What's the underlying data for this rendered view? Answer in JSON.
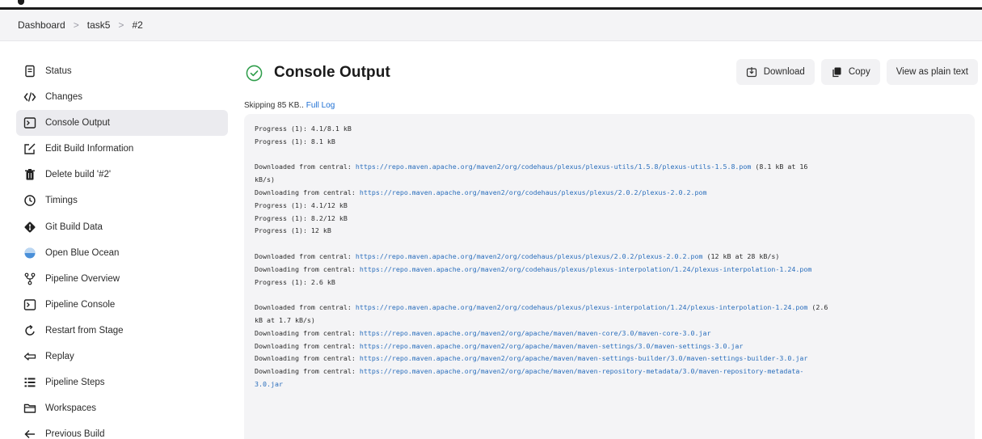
{
  "breadcrumb": {
    "items": [
      "Dashboard",
      "task5",
      "#2"
    ],
    "separator": ">"
  },
  "sidebar": {
    "items": [
      {
        "label": "Status",
        "icon": "document-icon"
      },
      {
        "label": "Changes",
        "icon": "code-icon"
      },
      {
        "label": "Console Output",
        "icon": "terminal-icon",
        "active": true
      },
      {
        "label": "Edit Build Information",
        "icon": "edit-icon"
      },
      {
        "label": "Delete build '#2'",
        "icon": "trash-icon"
      },
      {
        "label": "Timings",
        "icon": "clock-icon"
      },
      {
        "label": "Git Build Data",
        "icon": "git-icon"
      },
      {
        "label": "Open Blue Ocean",
        "icon": "blue-ocean-icon"
      },
      {
        "label": "Pipeline Overview",
        "icon": "pipeline-icon"
      },
      {
        "label": "Pipeline Console",
        "icon": "terminal-icon"
      },
      {
        "label": "Restart from Stage",
        "icon": "restart-icon"
      },
      {
        "label": "Replay",
        "icon": "replay-icon"
      },
      {
        "label": "Pipeline Steps",
        "icon": "list-icon"
      },
      {
        "label": "Workspaces",
        "icon": "folder-icon"
      },
      {
        "label": "Previous Build",
        "icon": "arrow-left-icon"
      }
    ]
  },
  "main": {
    "title": "Console Output",
    "actions": {
      "download": "Download",
      "copy": "Copy",
      "plain": "View as plain text"
    },
    "skip_text": "Skipping 85 KB..",
    "full_log": "Full Log"
  },
  "console": {
    "lines": [
      {
        "text": "Progress (1): 4.1/8.1 kB"
      },
      {
        "text": "Progress (1): 8.1 kB"
      },
      {
        "text": ""
      },
      {
        "prefix": "Downloaded from central: ",
        "url": "https://repo.maven.apache.org/maven2/org/codehaus/plexus/plexus-utils/1.5.8/plexus-utils-1.5.8.pom",
        "suffix": " (8.1 kB at 16"
      },
      {
        "text": "kB/s)"
      },
      {
        "prefix": "Downloading from central: ",
        "url": "https://repo.maven.apache.org/maven2/org/codehaus/plexus/plexus/2.0.2/plexus-2.0.2.pom"
      },
      {
        "text": "Progress (1): 4.1/12 kB"
      },
      {
        "text": "Progress (1): 8.2/12 kB"
      },
      {
        "text": "Progress (1): 12 kB"
      },
      {
        "text": ""
      },
      {
        "prefix": "Downloaded from central: ",
        "url": "https://repo.maven.apache.org/maven2/org/codehaus/plexus/plexus/2.0.2/plexus-2.0.2.pom",
        "suffix": " (12 kB at 28 kB/s)"
      },
      {
        "prefix": "Downloading from central: ",
        "url": "https://repo.maven.apache.org/maven2/org/codehaus/plexus/plexus-interpolation/1.24/plexus-interpolation-1.24.pom"
      },
      {
        "text": "Progress (1): 2.6 kB"
      },
      {
        "text": ""
      },
      {
        "prefix": "Downloaded from central: ",
        "url": "https://repo.maven.apache.org/maven2/org/codehaus/plexus/plexus-interpolation/1.24/plexus-interpolation-1.24.pom",
        "suffix": " (2.6"
      },
      {
        "text": "kB at 1.7 kB/s)"
      },
      {
        "prefix": "Downloading from central: ",
        "url": "https://repo.maven.apache.org/maven2/org/apache/maven/maven-core/3.0/maven-core-3.0.jar"
      },
      {
        "prefix": "Downloading from central: ",
        "url": "https://repo.maven.apache.org/maven2/org/apache/maven/maven-settings/3.0/maven-settings-3.0.jar"
      },
      {
        "prefix": "Downloading from central: ",
        "url": "https://repo.maven.apache.org/maven2/org/apache/maven/maven-settings-builder/3.0/maven-settings-builder-3.0.jar"
      },
      {
        "prefix": "Downloading from central: ",
        "url": "https://repo.maven.apache.org/maven2/org/apache/maven/maven-repository-metadata/3.0/maven-repository-metadata-"
      },
      {
        "url": "3.0.jar"
      }
    ]
  },
  "colors": {
    "success": "#2e9d4a",
    "link": "#1d6fd4",
    "console_url": "#2a6ebc",
    "console_bg": "#f4f4f6"
  }
}
